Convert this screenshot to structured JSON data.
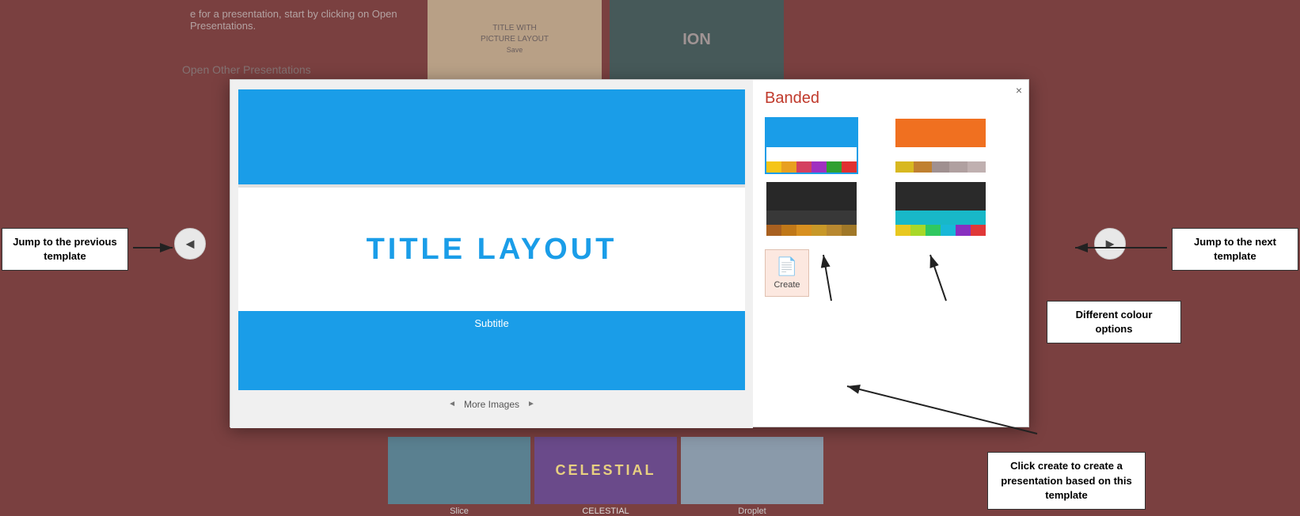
{
  "background": {
    "top_text_line1": "e for a presentation, start by clicking on Open",
    "top_text_line2": "Presentations.",
    "open_other_label": "Open Other Presentations"
  },
  "bg_thumbs": {
    "top": [
      {
        "label": "TITLE WITH\nPICTURE LAYOUT\nSave",
        "style": "title-pic"
      },
      {
        "label": "ION",
        "style": "ion"
      }
    ],
    "bottom": [
      {
        "label": "Slice",
        "style": "slice"
      },
      {
        "label": "CELESTIAL",
        "style": "celestial"
      },
      {
        "label": "Droplet",
        "style": "droplet"
      }
    ]
  },
  "dialog": {
    "close_label": "×",
    "title": "Banded",
    "preview": {
      "title": "TITLE LAYOUT",
      "subtitle": "Subtitle",
      "more_images_label": "More Images"
    },
    "swatches": [
      {
        "id": "sw1",
        "selected": true
      },
      {
        "id": "sw2",
        "selected": false
      },
      {
        "id": "sw3",
        "selected": false
      },
      {
        "id": "sw4",
        "selected": false
      }
    ],
    "create_button_label": "Create"
  },
  "callouts": {
    "prev_template": "Jump to the\nprevious template",
    "next_template": "Jump to the\nnext template",
    "create_hint": "Click create to create\na presentation based\non this template",
    "color_options": "Different colour\noptions"
  },
  "nav": {
    "prev_arrow": "◄",
    "next_arrow": "►"
  }
}
